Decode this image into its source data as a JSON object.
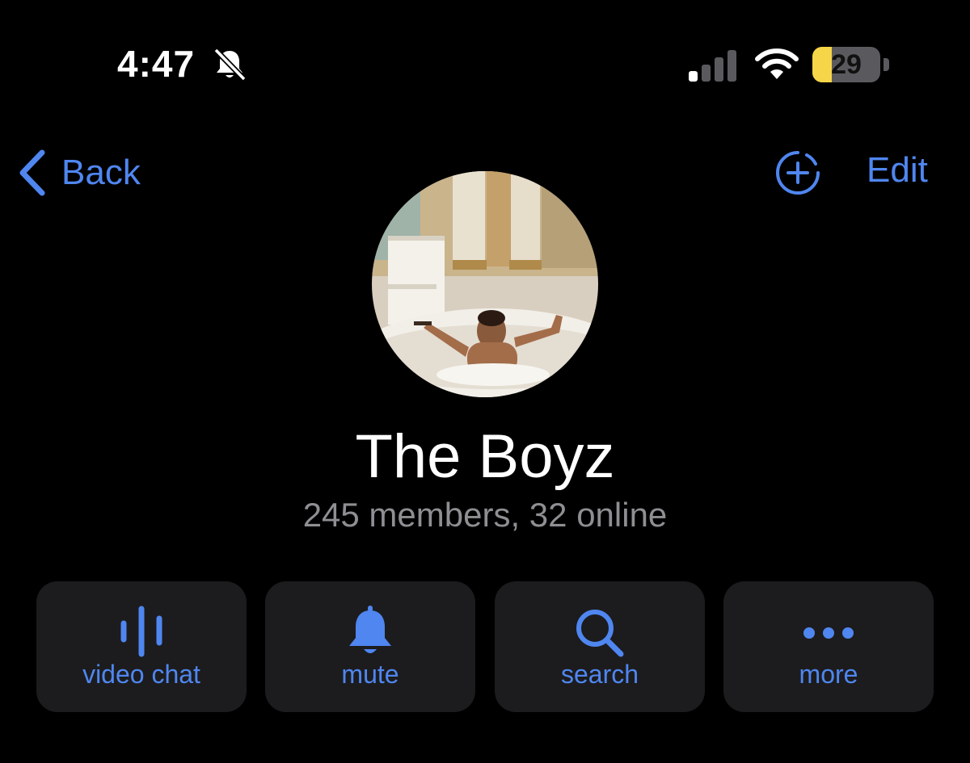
{
  "status_bar": {
    "time": "4:47",
    "battery_percent": "29",
    "battery_level": 0.29,
    "icons": [
      "bell-slash-icon",
      "cellular-signal-icon",
      "wifi-icon",
      "battery-icon"
    ]
  },
  "nav": {
    "back_label": "Back",
    "edit_label": "Edit",
    "icons": [
      "chevron-left-icon",
      "add-story-icon"
    ]
  },
  "group": {
    "name": "The Boyz",
    "subtitle": "245 members, 32 online"
  },
  "actions": [
    {
      "label": "video chat",
      "icon": "voice-chat-icon"
    },
    {
      "label": "mute",
      "icon": "bell-icon"
    },
    {
      "label": "search",
      "icon": "search-icon"
    },
    {
      "label": "more",
      "icon": "more-icon"
    }
  ],
  "colors": {
    "background": "#000000",
    "accent": "#4f86f0",
    "button_bg": "#1c1c1e",
    "secondary_text": "#8e8e93",
    "battery_fill": "#f7d548"
  }
}
